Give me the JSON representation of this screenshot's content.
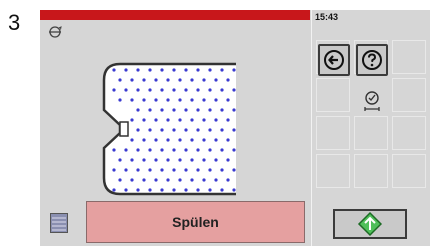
{
  "step_number": "3",
  "status": {
    "time": "15:43",
    "bar_color": "#c8171b"
  },
  "header": {
    "drum_icon": "drum-rotation-icon"
  },
  "buttons": {
    "back_icon": "back-arrow-icon",
    "help_icon": "question-icon",
    "timer_icon": "timer-icon",
    "start_icon": "start-diamond-icon"
  },
  "action": {
    "label": "Spülen",
    "color": "#e5a0a0"
  },
  "list_icon": "program-list-icon"
}
